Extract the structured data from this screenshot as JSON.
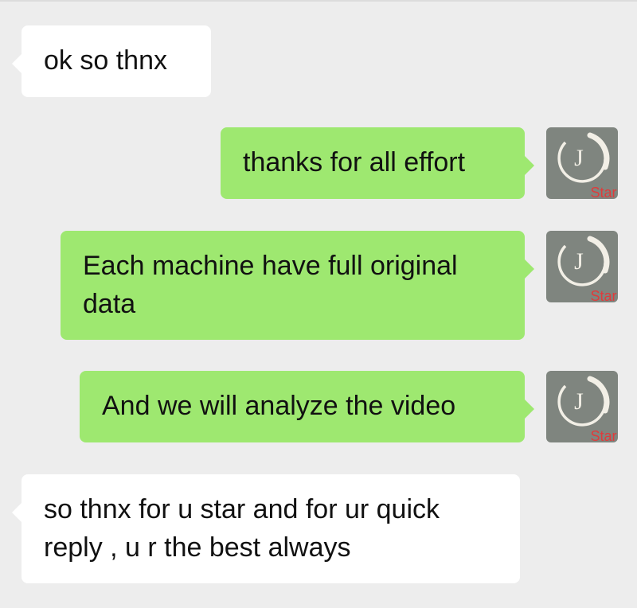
{
  "messages": [
    {
      "side": "left",
      "text": "ok so thnx"
    },
    {
      "side": "right",
      "text": "thanks for all effort"
    },
    {
      "side": "right",
      "text": "Each machine have full original data"
    },
    {
      "side": "right",
      "text": "And we will analyze the video"
    },
    {
      "side": "left",
      "text": "so thnx for u star and for ur quick reply , u r the best always"
    }
  ],
  "avatar": {
    "letter": "J",
    "caption": "Star"
  },
  "colors": {
    "background": "#ededed",
    "incoming": "#ffffff",
    "outgoing": "#9ee870",
    "avatar_caption": "#e03b3b"
  }
}
